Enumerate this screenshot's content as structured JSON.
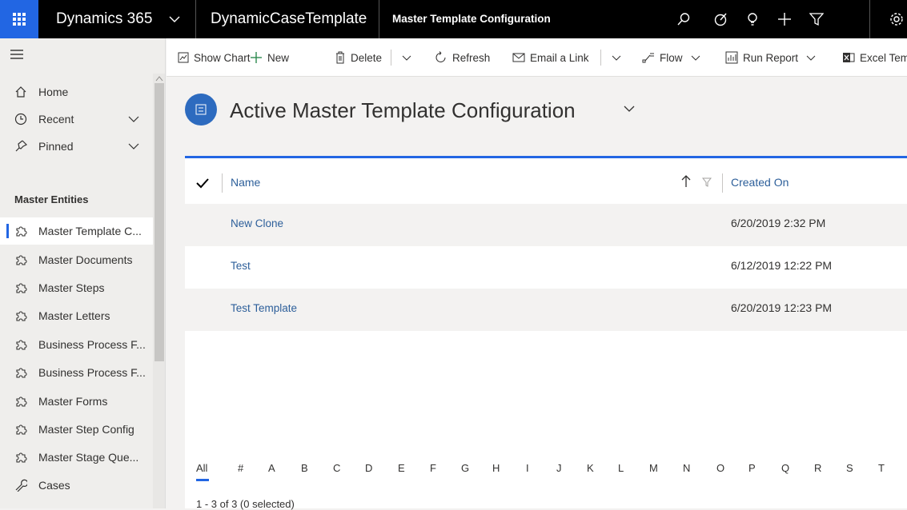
{
  "topbar": {
    "brand": "Dynamics 365",
    "app_name": "DynamicCaseTemplate",
    "page_title": "Master Template Configuration"
  },
  "nav": {
    "home": "Home",
    "recent": "Recent",
    "pinned": "Pinned",
    "section": "Master Entities",
    "items": [
      {
        "label": "Master Template C...",
        "icon": "puzzle-icon",
        "active": true
      },
      {
        "label": "Master Documents",
        "icon": "puzzle-icon"
      },
      {
        "label": "Master Steps",
        "icon": "puzzle-icon"
      },
      {
        "label": "Master Letters",
        "icon": "puzzle-icon"
      },
      {
        "label": "Business Process F...",
        "icon": "puzzle-icon"
      },
      {
        "label": "Business Process F...",
        "icon": "puzzle-icon"
      },
      {
        "label": "Master Forms",
        "icon": "puzzle-icon"
      },
      {
        "label": "Master Step Config",
        "icon": "puzzle-icon"
      },
      {
        "label": "Master Stage Que...",
        "icon": "puzzle-icon"
      },
      {
        "label": "Cases",
        "icon": "wrench-icon"
      }
    ]
  },
  "commands": {
    "show_chart": "Show Chart",
    "new": "New",
    "delete": "Delete",
    "refresh": "Refresh",
    "email_link": "Email a Link",
    "flow": "Flow",
    "run_report": "Run Report",
    "excel": "Excel Tem"
  },
  "view": {
    "title": "Active Master Template Configuration"
  },
  "grid": {
    "col_name": "Name",
    "col_created": "Created On",
    "rows": [
      {
        "name": "New Clone",
        "created": "6/20/2019 2:32 PM"
      },
      {
        "name": "Test",
        "created": "6/12/2019 12:22 PM"
      },
      {
        "name": "Test Template",
        "created": "6/20/2019 12:23 PM"
      }
    ],
    "alpha": [
      "All",
      "#",
      "A",
      "B",
      "C",
      "D",
      "E",
      "F",
      "G",
      "H",
      "I",
      "J",
      "K",
      "L",
      "M",
      "N",
      "O",
      "P",
      "Q",
      "R",
      "S",
      "T"
    ],
    "status": "1 - 3 of 3 (0 selected)"
  },
  "colors": {
    "accent": "#2266e3",
    "link": "#2d5f9a",
    "topbar": "#000000"
  }
}
